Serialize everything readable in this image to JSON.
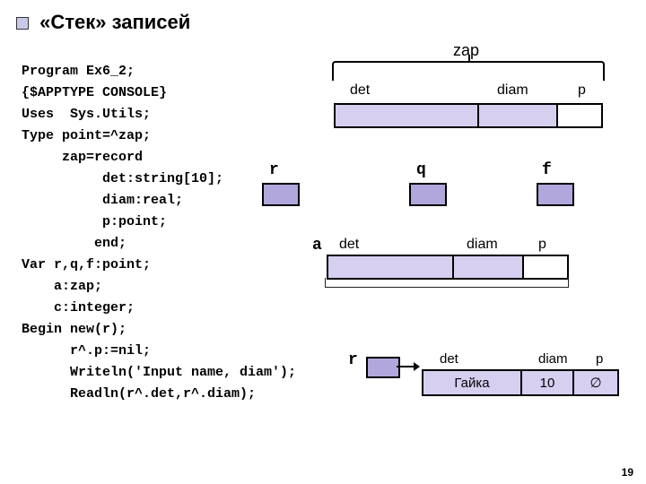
{
  "title": "«Стек» записей",
  "code": {
    "l1": "Program Ex6_2;",
    "l2": "{$APPTYPE CONSOLE}",
    "l3": "Uses  Sys.Utils;",
    "l4": "Type point=^zap;",
    "l5": "     zap=record",
    "l6": "          det:string[10];",
    "l7": "          diam:real;",
    "l8": "          p:point;",
    "l9": "         end;",
    "l10": "Var r,q,f:point;",
    "l11": "    a:zap;",
    "l12": "    c:integer;",
    "l13": "Begin new(r);",
    "l14": "      r^.p:=nil;",
    "l15": "      Writeln('Input name, diam');",
    "l16": "      Readln(r^.det,r^.diam);"
  },
  "diagram": {
    "zap_label": "zap",
    "fields": {
      "det": "det",
      "diam": "diam",
      "p": "p"
    },
    "pointers": {
      "r": "r",
      "q": "q",
      "f": "f"
    },
    "a_label": "a",
    "bottom": {
      "r": "r",
      "det_val": "Гайка",
      "diam_val": "10",
      "p_val": "∅"
    }
  },
  "page_number": "19"
}
